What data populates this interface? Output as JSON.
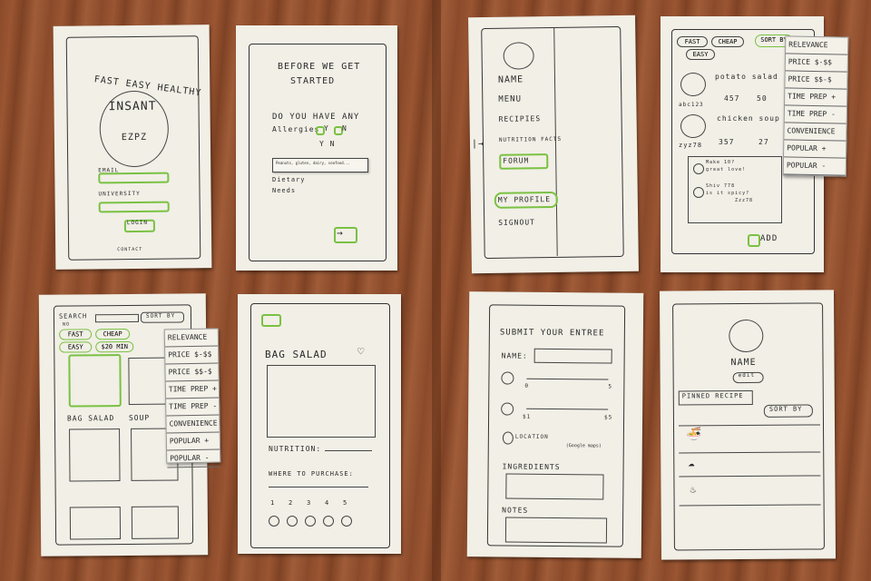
{
  "sketches": {
    "login": {
      "tagline": "FAST EASY HEALTHY",
      "logo_text": "INSANT",
      "logo_sub": "EZPZ",
      "email_label": "EMAIL",
      "university_label": "UNIVERSITY",
      "button_label": "LOGIN",
      "contact": "CONTACT"
    },
    "onboarding": {
      "heading_1": "BEFORE WE GET",
      "heading_2": "STARTED",
      "question_1": "DO YOU HAVE ANY",
      "allergies": "Allergies",
      "opt_y": "Y",
      "opt_n": "N",
      "row_2": "Y N",
      "popup_text": "Peanuts, gluten, dairy, seafood...",
      "row_3": "Dietary",
      "row_4": "Needs",
      "next_arrow": "→"
    },
    "menu": {
      "items": [
        "NAME",
        "MENU",
        "RECIPIES",
        "NUTRITION FACTS",
        "FORUM",
        "MY PROFILE",
        "SIGNOUT"
      ],
      "handle": "|→"
    },
    "forum": {
      "chips": [
        "FAST",
        "CHEAP",
        "SORT BY",
        "EASY"
      ],
      "entries": [
        {
          "title": "potato salad",
          "author": "abc123",
          "stats": [
            "457",
            "50"
          ]
        },
        {
          "title": "chicken soup",
          "author": "zyz78",
          "stats": [
            "357",
            "27"
          ]
        }
      ],
      "comment_1": "Make 10?",
      "comment_1b": "great love!",
      "comment_2": "Shiv 778",
      "comment_2b": "is it spicy?",
      "comment_2c": "Zzz78",
      "add_label": "ADD"
    },
    "sort_options": [
      "RELEVANCE",
      "PRICE $-$$",
      "PRICE $$-$",
      "TIME PREP +",
      "TIME PREP -",
      "CONVENIENCE",
      "POPULAR +",
      "POPULAR -"
    ],
    "search": {
      "search_label": "SEARCH",
      "sortby_label": "SORT BY",
      "no_label": "NO",
      "chips": [
        "FAST",
        "CHEAP",
        "EASY",
        "$20 MIN"
      ],
      "item_1": "BAG SALAD",
      "item_2": "SOUP"
    },
    "detail": {
      "title": "BAG SALAD",
      "nutrition": "NUTRITION:",
      "where": "WHERE TO PURCHASE:",
      "ratings": [
        "1",
        "2",
        "3",
        "4",
        "5"
      ]
    },
    "submit": {
      "heading": "SUBMIT YOUR ENTREE",
      "name_label": "NAME:",
      "time_min": "0",
      "time_max": "5",
      "cost_min": "$1",
      "cost_max": "$5",
      "location_label": "LOCATION",
      "location_hint": "(Google maps)",
      "ingredients_label": "INGREDIENTS",
      "notes_label": "NOTES"
    },
    "profile": {
      "name_label": "NAME",
      "edit_label": "edit",
      "tab_label": "PINNED RECIPE",
      "sort_label": "SORT BY"
    }
  }
}
